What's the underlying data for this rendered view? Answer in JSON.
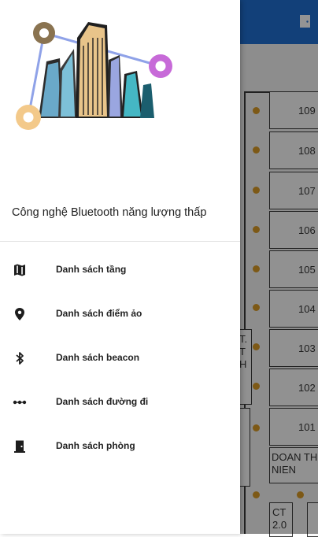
{
  "drawer": {
    "subtitle": "Công nghệ Bluetooth năng lượng thấp",
    "menu": [
      {
        "label": "Danh sách tầng",
        "icon": "map-icon"
      },
      {
        "label": "Danh sách điểm ảo",
        "icon": "location-pin-icon"
      },
      {
        "label": "Danh sách beacon",
        "icon": "bluetooth-icon"
      },
      {
        "label": "Danh sách đường đi",
        "icon": "dots-line-icon"
      },
      {
        "label": "Danh sách phòng",
        "icon": "door-icon"
      }
    ]
  },
  "floor_plan": {
    "rooms": [
      "109",
      "108",
      "107",
      "106",
      "105",
      "104",
      "103",
      "102",
      "101"
    ],
    "room_wide": "DOAN TH.. NIEN",
    "room_wide_line1": "DOAN TH.",
    "room_wide_line2": "NIEN",
    "side_room_top_line1": "T.",
    "side_room_top_line2": "T",
    "side_room_top_line3": "H",
    "bottom_room_line1": "CT",
    "bottom_room_line2": "2.0"
  },
  "colors": {
    "app_bar": "#1f6fd1",
    "marker": "#d89a26"
  }
}
